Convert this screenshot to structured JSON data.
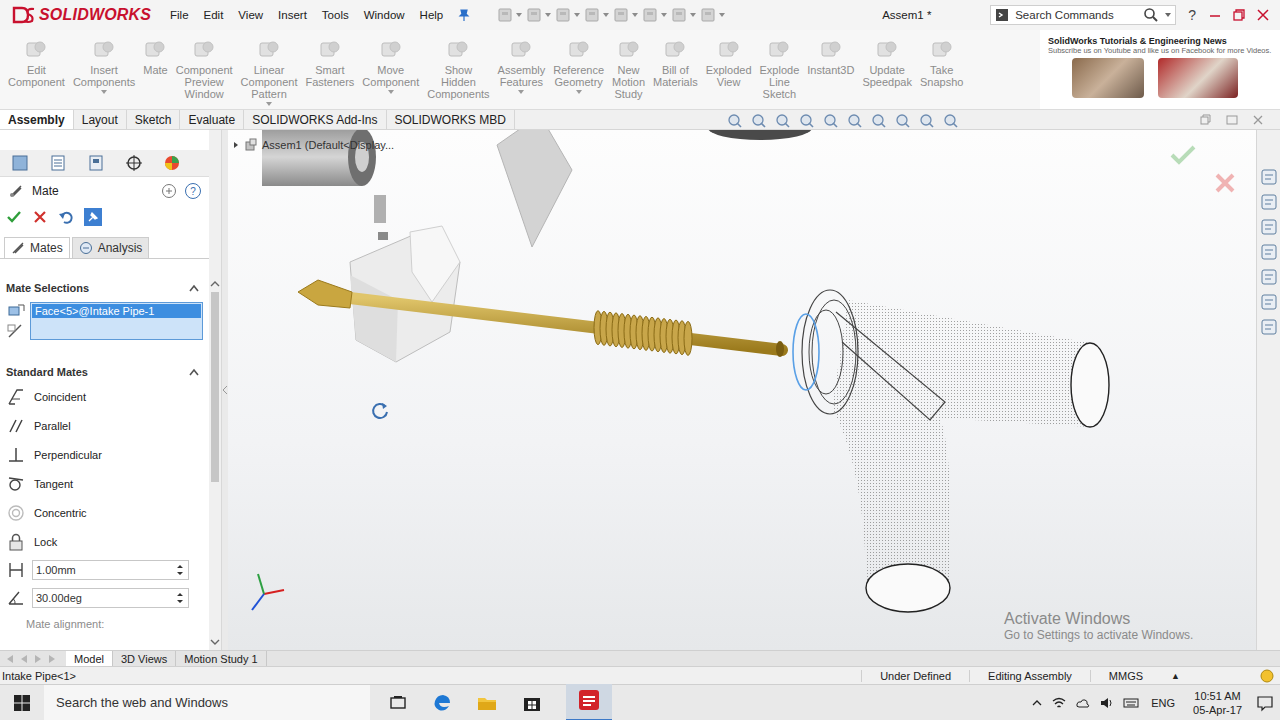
{
  "titlebar": {
    "logo": "SOLIDWORKS",
    "menu": [
      "File",
      "Edit",
      "View",
      "Insert",
      "Tools",
      "Window",
      "Help"
    ],
    "document": "Assem1 *",
    "search": {
      "placeholder": "Search Commands"
    },
    "help": "?"
  },
  "commands": [
    {
      "label": "Edit Component",
      "dropdown": false,
      "disabled": true
    },
    {
      "label": "Insert Components",
      "dropdown": true,
      "disabled": true
    },
    {
      "label": "Mate",
      "dropdown": false,
      "disabled": true
    },
    {
      "label": "Component Preview Window",
      "dropdown": false,
      "disabled": true
    },
    {
      "label": "Linear Component Pattern",
      "dropdown": true,
      "disabled": true
    },
    {
      "label": "Smart Fasteners",
      "dropdown": false,
      "disabled": true
    },
    {
      "label": "Move Component",
      "dropdown": true,
      "disabled": true
    },
    {
      "label": "Show Hidden Components",
      "dropdown": false,
      "disabled": true
    },
    {
      "label": "Assembly Features",
      "dropdown": true,
      "disabled": true
    },
    {
      "label": "Reference Geometry",
      "dropdown": true,
      "disabled": true
    },
    {
      "label": "New Motion Study",
      "dropdown": false,
      "disabled": true
    },
    {
      "label": "Bill of Materials",
      "dropdown": false,
      "disabled": true
    },
    {
      "label": "Exploded View",
      "dropdown": false,
      "disabled": true
    },
    {
      "label": "Explode Line Sketch",
      "dropdown": false,
      "disabled": true
    },
    {
      "label": "Instant3D",
      "dropdown": false,
      "disabled": true
    },
    {
      "label": "Update Speedpak",
      "dropdown": false,
      "disabled": true
    },
    {
      "label": "Take Snapsho",
      "dropdown": false,
      "disabled": true
    }
  ],
  "banner": {
    "title": "SolidWorks Tutorials & Engineering News",
    "subtitle": "Subscribe us on Youtube and like us on Facebook for more Videos."
  },
  "ribbon_tabs": [
    {
      "label": "Assembly",
      "selected": true
    },
    {
      "label": "Layout",
      "selected": false
    },
    {
      "label": "Sketch",
      "selected": false
    },
    {
      "label": "Evaluate",
      "selected": false
    },
    {
      "label": "SOLIDWORKS Add-Ins",
      "selected": false
    },
    {
      "label": "SOLIDWORKS MBD",
      "selected": false
    }
  ],
  "panel": {
    "title": "Mate",
    "help": "?",
    "tabs": [
      {
        "label": "Mates",
        "selected": true
      },
      {
        "label": "Analysis",
        "selected": false
      }
    ],
    "selections": {
      "title": "Mate Selections",
      "items": [
        {
          "label": "Face<5>@Intake Pipe-1",
          "selected": true
        }
      ]
    },
    "standard": {
      "title": "Standard Mates",
      "mates": [
        {
          "label": "Coincident",
          "kind": "coincident"
        },
        {
          "label": "Parallel",
          "kind": "parallel"
        },
        {
          "label": "Perpendicular",
          "kind": "perpendicular"
        },
        {
          "label": "Tangent",
          "kind": "tangent"
        },
        {
          "label": "Concentric",
          "kind": "concentric"
        },
        {
          "label": "Lock",
          "kind": "lock"
        }
      ],
      "distance": "1.00mm",
      "angle": "30.00deg"
    },
    "alignment": "Mate alignment:"
  },
  "viewport": {
    "tree": "Assem1  (Default<Display...",
    "watermark": {
      "title": "Activate Windows",
      "subtitle": "Go to Settings to activate Windows."
    }
  },
  "bottom_tabs": [
    {
      "label": "Model",
      "selected": true
    },
    {
      "label": "3D Views",
      "selected": false
    },
    {
      "label": "Motion Study 1",
      "selected": false
    }
  ],
  "status": {
    "selection": "Intake Pipe<1>",
    "fields": [
      "Under Defined",
      "Editing Assembly",
      "MMGS"
    ],
    "units_menu": "▲"
  },
  "taskbar": {
    "search": "Search the web and Windows",
    "language": "ENG",
    "time": "10:51 AM",
    "date": "05-Apr-17"
  }
}
